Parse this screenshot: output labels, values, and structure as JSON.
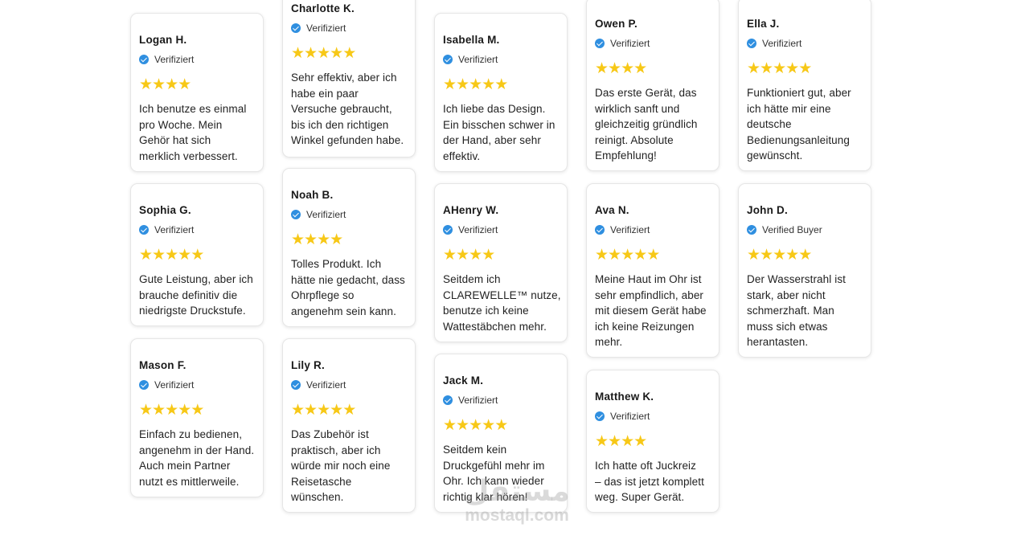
{
  "reviews": [
    {
      "name": "Logan H.",
      "badge": "Verifiziert",
      "stars": 4,
      "lines": [
        "Ich benutze es einmal",
        "pro Woche. Mein",
        "Gehör hat sich",
        "merklich verbessert."
      ]
    },
    {
      "name": "Sophia G.",
      "badge": "Verifiziert",
      "stars": 5,
      "lines": [
        "Gute Leistung, aber ich",
        "brauche definitiv die",
        "niedrigste Druckstufe."
      ]
    },
    {
      "name": "Mason F.",
      "badge": "Verifiziert",
      "stars": 5,
      "lines": [
        "Einfach zu bedienen,",
        "angenehm in der Hand.",
        "Auch mein Partner",
        "nutzt es mittlerweile."
      ]
    },
    {
      "name": "Charlotte K.",
      "badge": "Verifiziert",
      "stars": 5,
      "lines": [
        "Sehr effektiv, aber ich",
        "habe ein paar",
        "Versuche gebraucht,",
        "bis ich den richtigen",
        "Winkel gefunden habe."
      ]
    },
    {
      "name": "Noah B.",
      "badge": "Verifiziert",
      "stars": 4,
      "lines": [
        "Tolles Produkt. Ich",
        "hätte nie gedacht, dass",
        "Ohrpflege so",
        "angenehm sein kann."
      ]
    },
    {
      "name": "Lily R.",
      "badge": "Verifiziert",
      "stars": 5,
      "lines": [
        "Das Zubehör ist",
        "praktisch, aber ich",
        "würde mir noch eine",
        "Reisetasche",
        "wünschen."
      ]
    },
    {
      "name": "Isabella M.",
      "badge": "Verifiziert",
      "stars": 5,
      "lines": [
        "Ich liebe das Design.",
        "Ein bisschen schwer in",
        "der Hand, aber sehr",
        "effektiv."
      ]
    },
    {
      "name": "AHenry W.",
      "badge": "Verifiziert",
      "stars": 4,
      "lines": [
        "Seitdem ich",
        "CLAREWELLE™ nutze,",
        "benutze ich keine",
        "Wattestäbchen mehr."
      ]
    },
    {
      "name": "Jack M.",
      "badge": "Verifiziert",
      "stars": 5,
      "lines": [
        "Seitdem kein",
        "Druckgefühl mehr im",
        "Ohr. Ich kann wieder",
        "richtig klar hören!"
      ]
    },
    {
      "name": "Owen P.",
      "badge": "Verifiziert",
      "stars": 4,
      "lines": [
        "Das erste Gerät, das",
        "wirklich sanft und",
        "gleichzeitig gründlich",
        "reinigt. Absolute",
        "Empfehlung!"
      ]
    },
    {
      "name": "Ava N.",
      "badge": "Verifiziert",
      "stars": 5,
      "lines": [
        "Meine Haut im Ohr ist",
        "sehr empfindlich, aber",
        "mit diesem Gerät habe",
        "ich keine Reizungen",
        "mehr."
      ]
    },
    {
      "name": "Matthew K.",
      "badge": "Verifiziert",
      "stars": 4,
      "lines": [
        "Ich hatte oft Juckreiz",
        "– das ist jetzt komplett",
        "weg. Super Gerät."
      ]
    },
    {
      "name": "Ella J.",
      "badge": "Verifiziert",
      "stars": 5,
      "lines": [
        "Funktioniert gut, aber",
        "ich hätte mir eine",
        "deutsche",
        "Bedienungsanleitung",
        "gewünscht."
      ]
    },
    {
      "name": "John D.",
      "badge": "Verified Buyer",
      "stars": 5,
      "lines": [
        "Der Wasserstrahl ist",
        "stark, aber nicht",
        "schmerzhaft. Man",
        "muss sich etwas",
        "herantasten."
      ]
    }
  ],
  "watermark": {
    "arabic": "مستقل",
    "latin": "mostaql.com"
  },
  "colors": {
    "star": "#f7c817",
    "verified_icon": "#2f8fe0",
    "card_border": "#e6e6e6"
  }
}
